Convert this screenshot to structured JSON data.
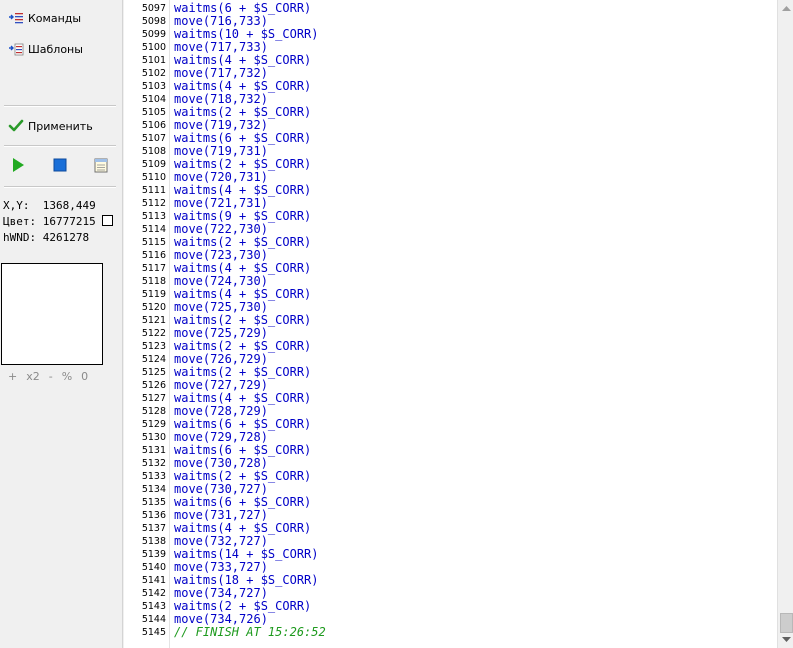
{
  "sidebar": {
    "commands_label": "Команды",
    "templates_label": "Шаблоны",
    "apply_label": "Применить",
    "coords_label": "X,Y:",
    "coords_value": "1368,449",
    "color_label": "Цвет:",
    "color_value": "16777215",
    "hwnd_label": "hWND:",
    "hwnd_value": "4261278",
    "zoom": {
      "plus": "+",
      "x2": "x2",
      "minus": "-",
      "percent": "%",
      "zero": "0"
    }
  },
  "icons": {
    "commands": "commands-icon",
    "templates": "templates-icon",
    "apply": "check-icon",
    "play": "play-icon",
    "stop": "stop-icon",
    "notepad": "notepad-icon"
  },
  "colors": {
    "code": "#0000c8",
    "comment": "#1e9a1e",
    "play": "#22aa22",
    "stop": "#1a6fd8"
  },
  "editor": {
    "lines": [
      {
        "num": "5097",
        "text": "waitms(6 + $S_CORR)"
      },
      {
        "num": "5098",
        "text": "move(716,733)"
      },
      {
        "num": "5099",
        "text": "waitms(10 + $S_CORR)"
      },
      {
        "num": "5100",
        "text": "move(717,733)"
      },
      {
        "num": "5101",
        "text": "waitms(4 + $S_CORR)"
      },
      {
        "num": "5102",
        "text": "move(717,732)"
      },
      {
        "num": "5103",
        "text": "waitms(4 + $S_CORR)"
      },
      {
        "num": "5104",
        "text": "move(718,732)"
      },
      {
        "num": "5105",
        "text": "waitms(2 + $S_CORR)"
      },
      {
        "num": "5106",
        "text": "move(719,732)"
      },
      {
        "num": "5107",
        "text": "waitms(6 + $S_CORR)"
      },
      {
        "num": "5108",
        "text": "move(719,731)"
      },
      {
        "num": "5109",
        "text": "waitms(2 + $S_CORR)"
      },
      {
        "num": "5110",
        "text": "move(720,731)"
      },
      {
        "num": "5111",
        "text": "waitms(4 + $S_CORR)"
      },
      {
        "num": "5112",
        "text": "move(721,731)"
      },
      {
        "num": "5113",
        "text": "waitms(9 + $S_CORR)"
      },
      {
        "num": "5114",
        "text": "move(722,730)"
      },
      {
        "num": "5115",
        "text": "waitms(2 + $S_CORR)"
      },
      {
        "num": "5116",
        "text": "move(723,730)"
      },
      {
        "num": "5117",
        "text": "waitms(4 + $S_CORR)"
      },
      {
        "num": "5118",
        "text": "move(724,730)"
      },
      {
        "num": "5119",
        "text": "waitms(4 + $S_CORR)"
      },
      {
        "num": "5120",
        "text": "move(725,730)"
      },
      {
        "num": "5121",
        "text": "waitms(2 + $S_CORR)"
      },
      {
        "num": "5122",
        "text": "move(725,729)"
      },
      {
        "num": "5123",
        "text": "waitms(2 + $S_CORR)"
      },
      {
        "num": "5124",
        "text": "move(726,729)"
      },
      {
        "num": "5125",
        "text": "waitms(2 + $S_CORR)"
      },
      {
        "num": "5126",
        "text": "move(727,729)"
      },
      {
        "num": "5127",
        "text": "waitms(4 + $S_CORR)"
      },
      {
        "num": "5128",
        "text": "move(728,729)"
      },
      {
        "num": "5129",
        "text": "waitms(6 + $S_CORR)"
      },
      {
        "num": "5130",
        "text": "move(729,728)"
      },
      {
        "num": "5131",
        "text": "waitms(6 + $S_CORR)"
      },
      {
        "num": "5132",
        "text": "move(730,728)"
      },
      {
        "num": "5133",
        "text": "waitms(2 + $S_CORR)"
      },
      {
        "num": "5134",
        "text": "move(730,727)"
      },
      {
        "num": "5135",
        "text": "waitms(6 + $S_CORR)"
      },
      {
        "num": "5136",
        "text": "move(731,727)"
      },
      {
        "num": "5137",
        "text": "waitms(4 + $S_CORR)"
      },
      {
        "num": "5138",
        "text": "move(732,727)"
      },
      {
        "num": "5139",
        "text": "waitms(14 + $S_CORR)"
      },
      {
        "num": "5140",
        "text": "move(733,727)"
      },
      {
        "num": "5141",
        "text": "waitms(18 + $S_CORR)"
      },
      {
        "num": "5142",
        "text": "move(734,727)"
      },
      {
        "num": "5143",
        "text": "waitms(2 + $S_CORR)"
      },
      {
        "num": "5144",
        "text": "move(734,726)"
      },
      {
        "num": "5145",
        "text": "// FINISH AT 15:26:52",
        "comment": true
      }
    ]
  }
}
